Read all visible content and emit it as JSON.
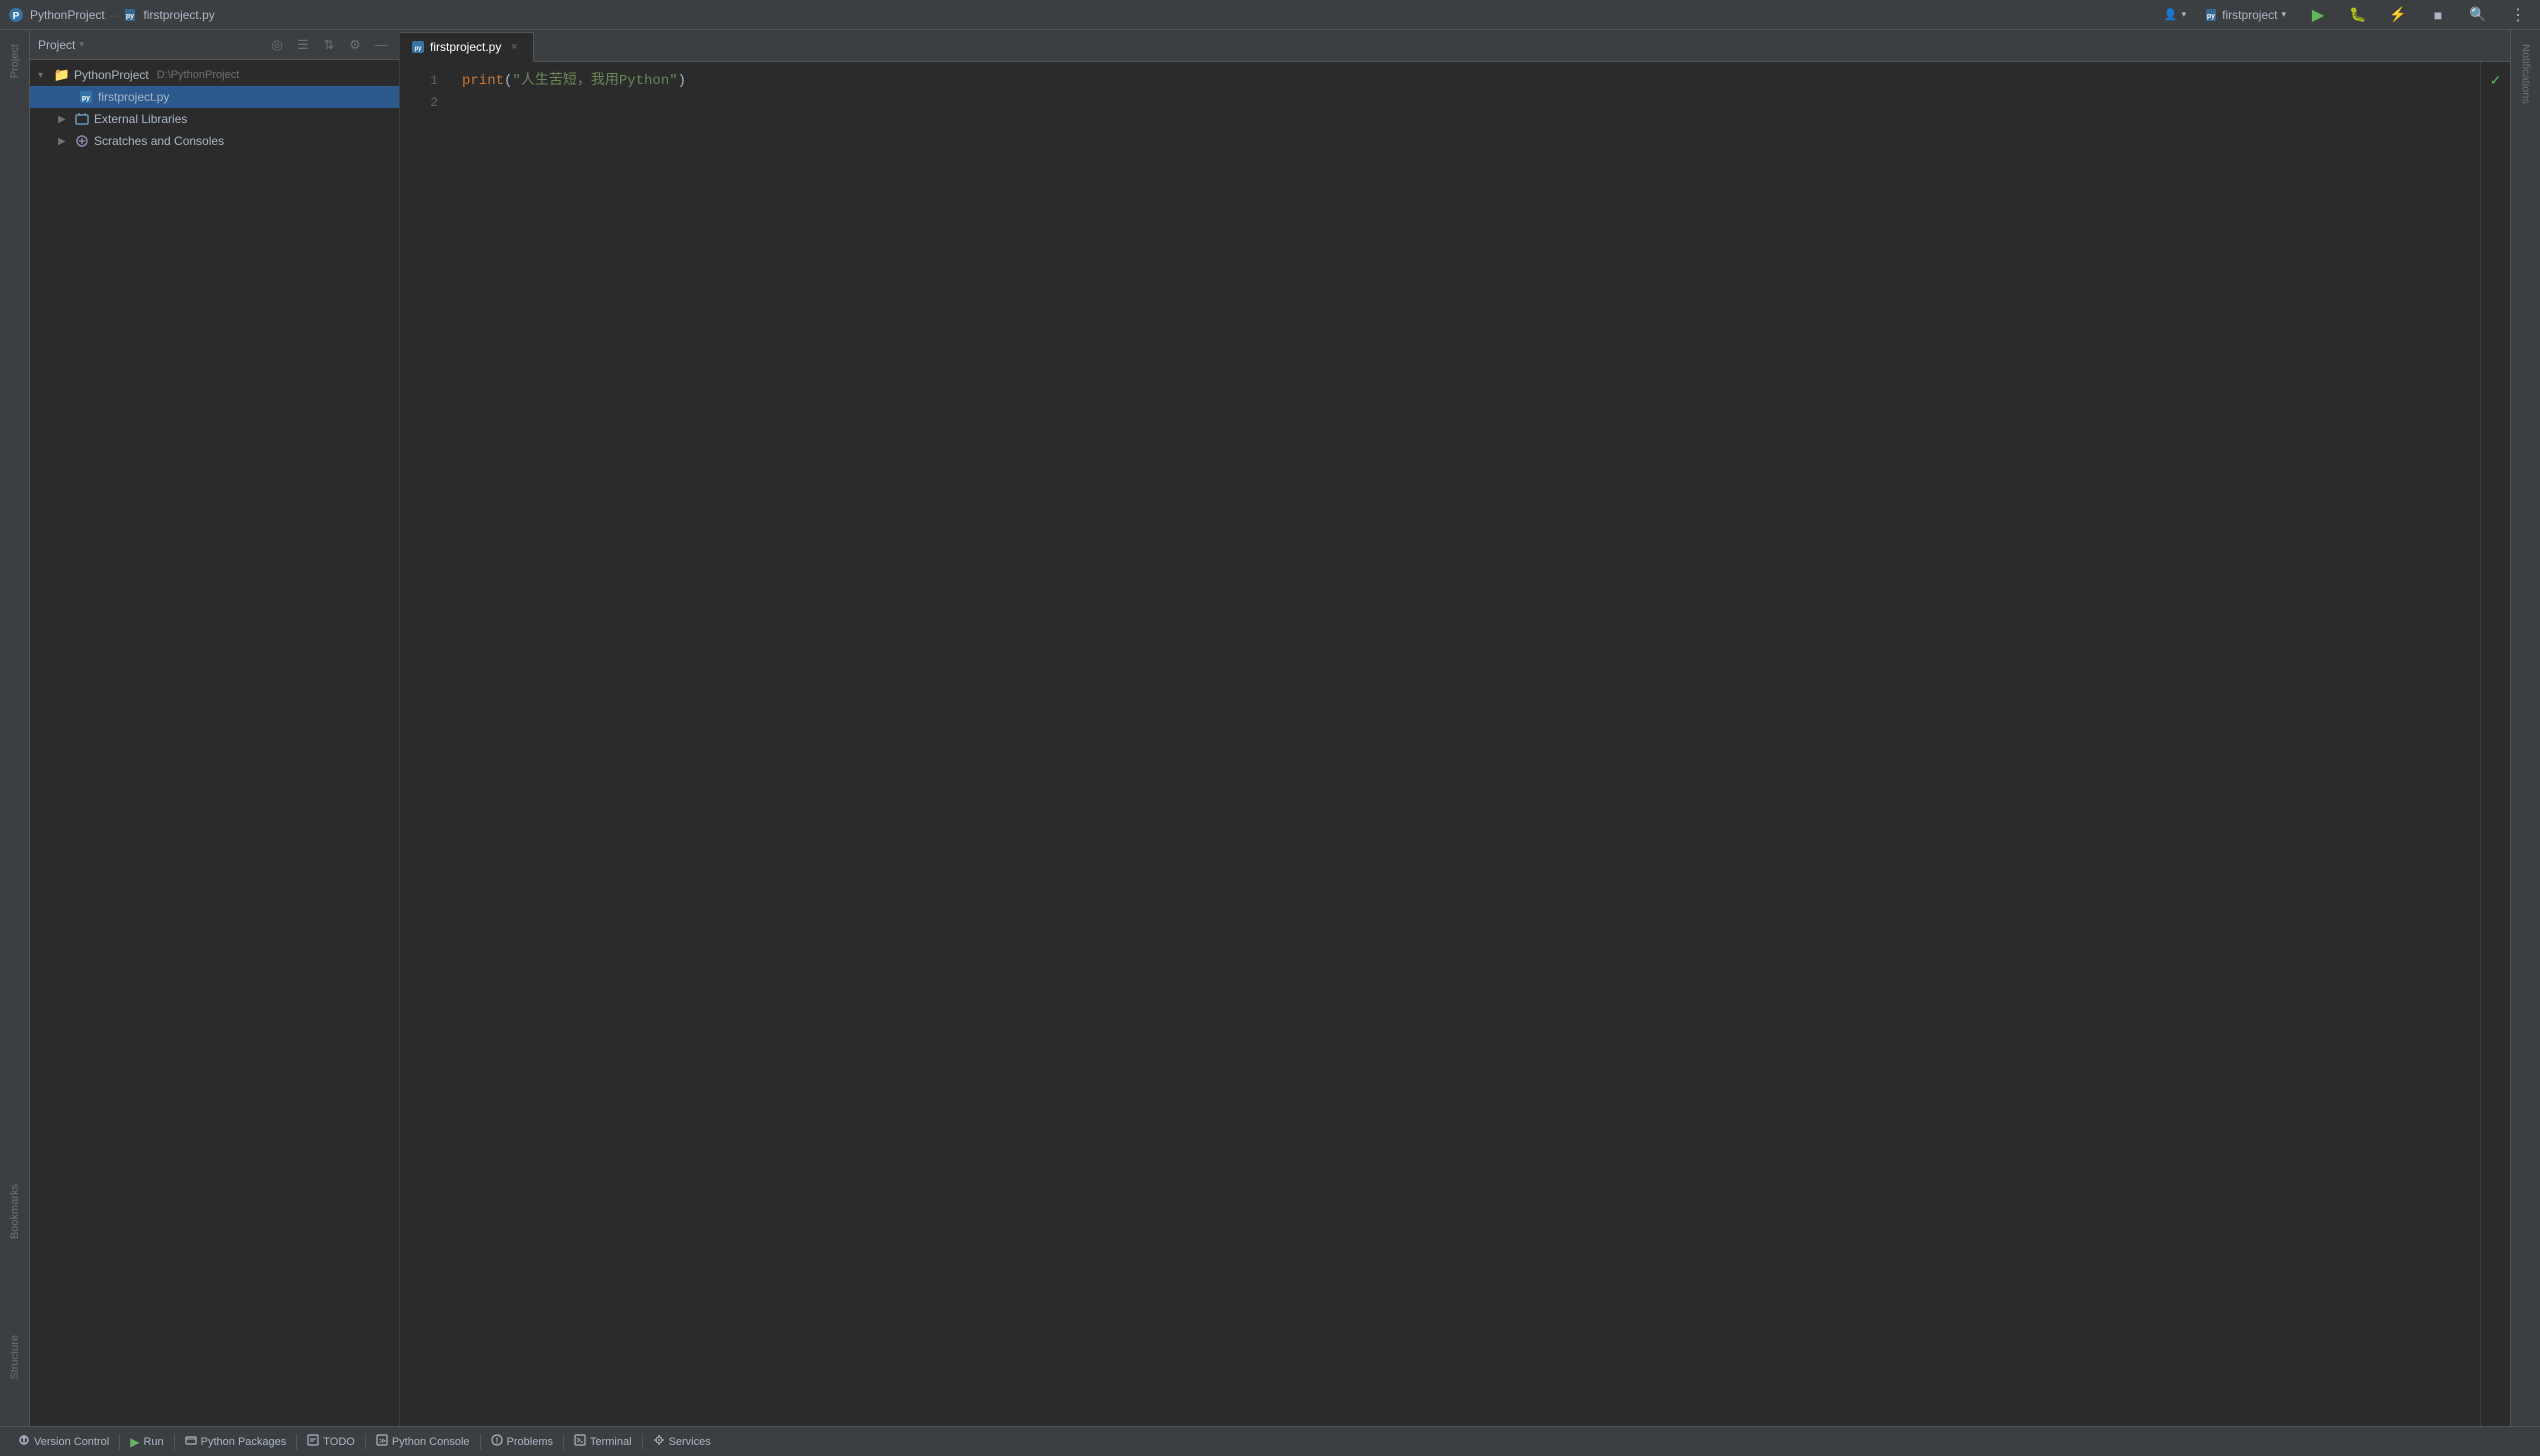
{
  "titlebar": {
    "app_name": "PythonProject",
    "file_name": "firstproject.py",
    "user_icon": "👤",
    "run_config": "firstproject",
    "chevron_down": "▾"
  },
  "toolbar": {
    "project_label": "Project",
    "project_chevron": "▾",
    "sync_icon": "⟳",
    "structure_icon": "≡",
    "sort_icon": "⇅",
    "settings_icon": "⚙",
    "close_icon": "—"
  },
  "project_tree": {
    "root_name": "PythonProject",
    "root_path": "D:\\PythonProject",
    "file_name": "firstproject.py",
    "external_libs": "External Libraries",
    "scratches": "Scratches and Consoles"
  },
  "editor": {
    "tab_name": "firstproject.py",
    "close_icon": "×",
    "lines": [
      {
        "number": 1,
        "code_raw": "print(\"人生苦短，我用Python\")"
      },
      {
        "number": 2,
        "code_raw": ""
      }
    ]
  },
  "statusbar": {
    "version_control": "Version Control",
    "run": "Run",
    "python_packages": "Python Packages",
    "todo": "TODO",
    "python_console": "Python Console",
    "problems": "Problems",
    "terminal": "Terminal",
    "services": "Services"
  },
  "right_strip": {
    "notifications": "Notifications"
  }
}
